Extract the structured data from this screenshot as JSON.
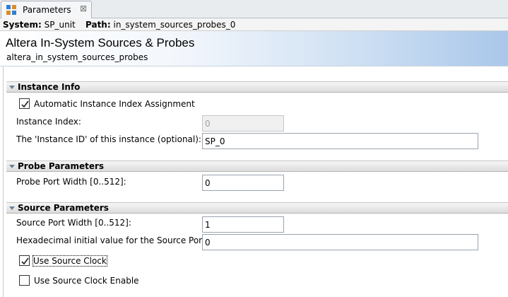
{
  "tab": {
    "title": "Parameters",
    "close_glyph": "⊠",
    "icon": "parameters-icon"
  },
  "system_line": {
    "system_label": "System:",
    "system_value": "SP_unit",
    "path_label": "Path:",
    "path_value": "in_system_sources_probes_0"
  },
  "banner": {
    "title": "Altera In-System Sources & Probes",
    "subtitle": "altera_in_system_sources_probes"
  },
  "sections": {
    "instance_info": {
      "title": "Instance Info",
      "auto_index_label": "Automatic Instance Index Assignment",
      "auto_index_checked": true,
      "index_label": "Instance Index:",
      "index_value": "0",
      "id_label": "The 'Instance ID' of this instance (optional):",
      "id_value": "SP_0"
    },
    "probe": {
      "title": "Probe Parameters",
      "width_label": "Probe Port Width [0..512]:",
      "width_value": "0"
    },
    "source": {
      "title": "Source Parameters",
      "width_label": "Source Port Width [0..512]:",
      "width_value": "1",
      "hex_label": "Hexadecimal initial value for the Source Port:",
      "hex_value": "0",
      "use_clock_label": "Use Source Clock",
      "use_clock_checked": true,
      "use_clock_enable_label": "Use Source Clock Enable",
      "use_clock_enable_checked": false
    }
  },
  "colors": {
    "banner_gradient_end": "#a9c7ea",
    "section_header": "#dcdcdc"
  }
}
